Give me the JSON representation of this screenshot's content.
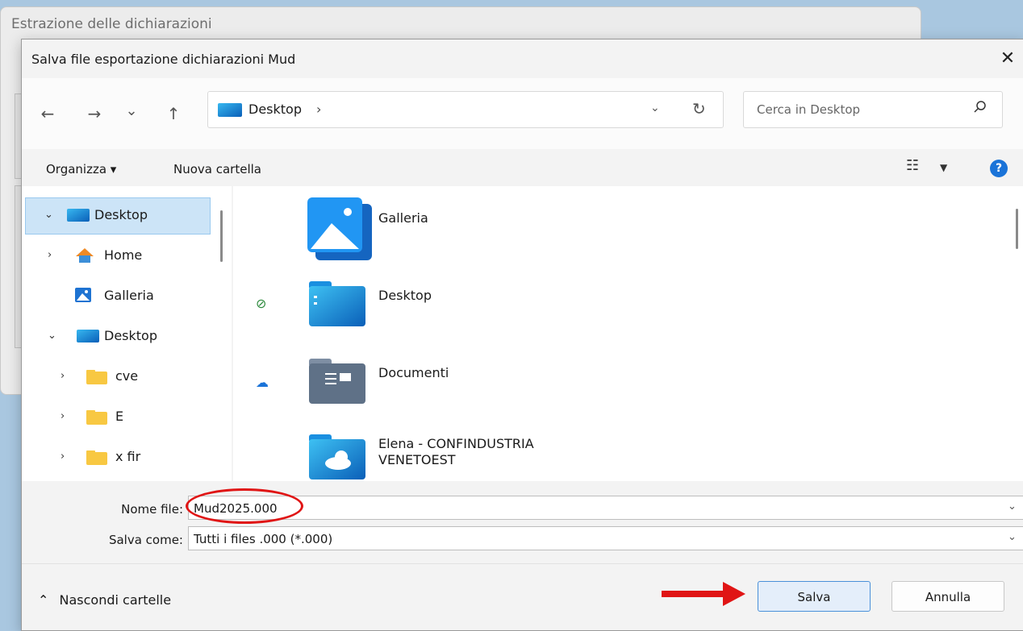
{
  "background_window": {
    "title": "Estrazione delle dichiarazioni"
  },
  "dialog": {
    "title": "Salva file esportazione dichiarazioni Mud",
    "close_glyph": "✕"
  },
  "navigation": {
    "back_glyph": "←",
    "forward_glyph": "→",
    "recent_glyph": "⌄",
    "up_glyph": "↑",
    "address": "Desktop",
    "address_sep": "›",
    "address_dropdown_glyph": "⌄",
    "refresh_glyph": "↻",
    "search_placeholder": "Cerca in Desktop",
    "search_glyph": "⚲"
  },
  "toolbar": {
    "organize": "Organizza ▾",
    "new_folder": "Nuova cartella",
    "view_glyph": "☷",
    "view_dd_glyph": "▼",
    "help_glyph": "?"
  },
  "nav_tree": [
    {
      "label": "Desktop",
      "chevron": "⌄"
    },
    {
      "label": "Home",
      "chevron": "›"
    },
    {
      "label": "Galleria",
      "chevron": ""
    },
    {
      "label": "Desktop",
      "chevron": "⌄"
    },
    {
      "label": "cve",
      "chevron": "›"
    },
    {
      "label": "E",
      "chevron": "›"
    },
    {
      "label": "x fir",
      "chevron": "›"
    }
  ],
  "items": [
    {
      "name": "Galleria",
      "status": ""
    },
    {
      "name": "Desktop",
      "status": "⊘"
    },
    {
      "name": "Documenti",
      "status": "☁"
    },
    {
      "name_line1": "Elena - CONFINDUSTRIA",
      "name_line2": "VENETOEST",
      "status": ""
    }
  ],
  "form": {
    "filename_label": "Nome file:",
    "filename_value": "Mud2025.000",
    "savetype_label": "Salva come:",
    "savetype_value": "Tutti i files .000 (*.000)",
    "dd_glyph": "⌄"
  },
  "footer": {
    "hide_folders": "Nascondi cartelle",
    "hide_glyph": "⌃",
    "save": "Salva",
    "cancel": "Annulla"
  },
  "colors": {
    "accent": "#1a73d8",
    "annotation": "#e01515",
    "selection": "#cce4f7"
  }
}
